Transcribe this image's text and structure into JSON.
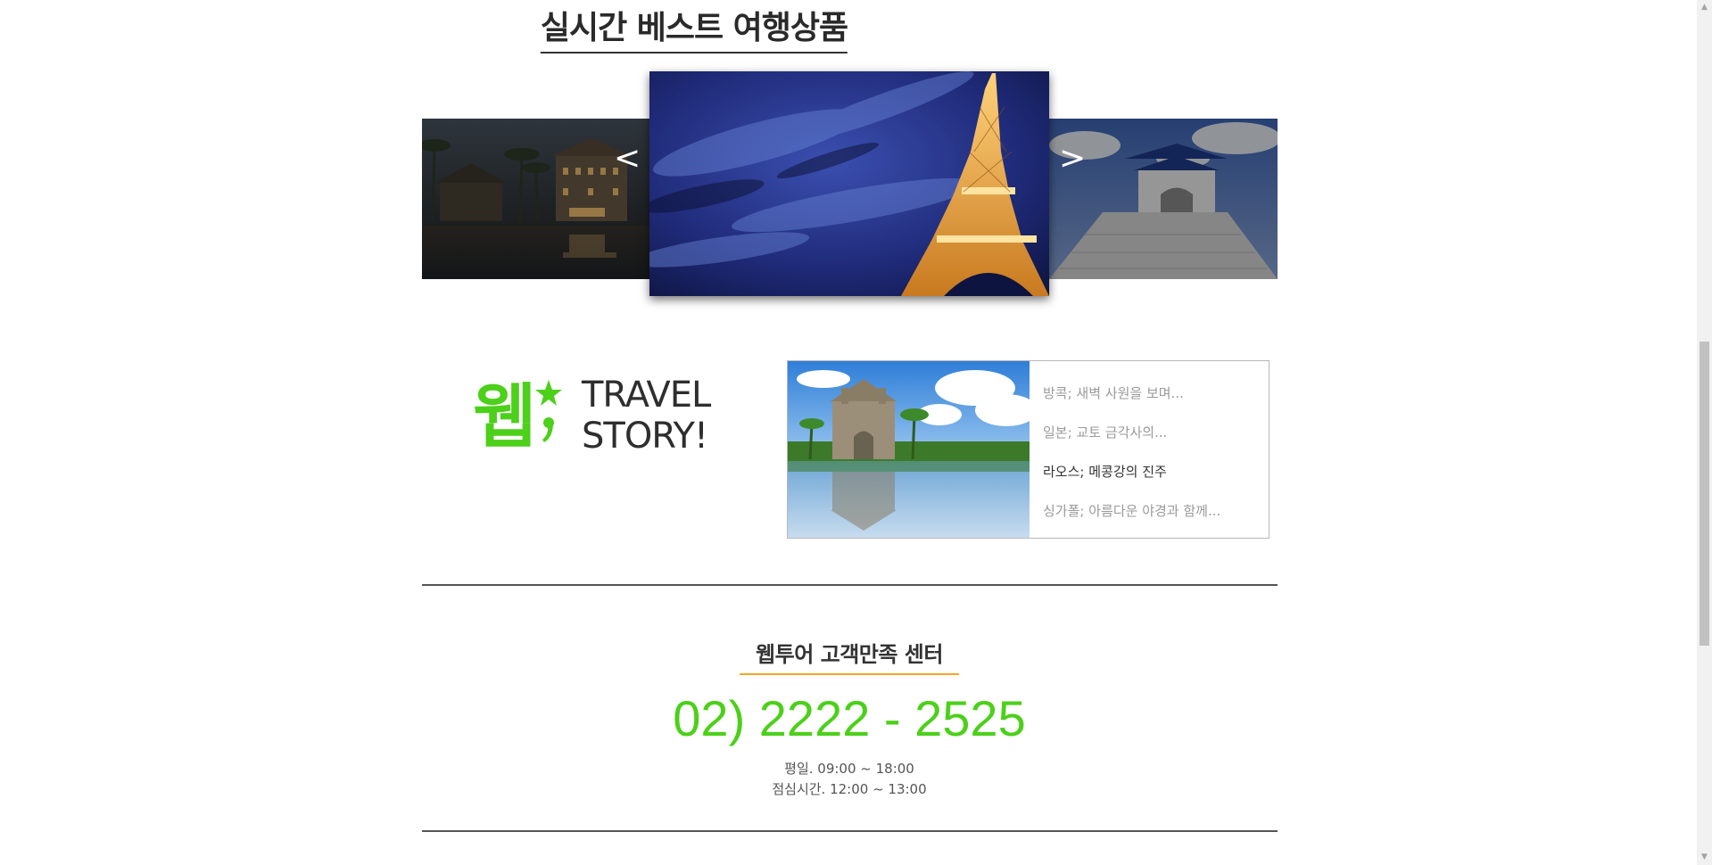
{
  "best": {
    "title": "실시간 베스트 여행상품",
    "prev_label": "<",
    "next_label": ">"
  },
  "story": {
    "logo_text": "웹",
    "title_line1": "TRAVEL",
    "title_line2": "STORY!",
    "items": [
      {
        "label": "방콕; 새벽 사원을 보며..."
      },
      {
        "label": "일본; 교토 금각사의..."
      },
      {
        "label": "라오스; 메콩강의 진주"
      },
      {
        "label": "싱가폴; 아름다운 야경과 함께..."
      }
    ],
    "active_index": 2
  },
  "customer_center": {
    "title": "웹투어 고객만족 센터",
    "phone": "02) 2222 - 2525",
    "hours_weekday": "평일. 09:00 ~ 18:00",
    "hours_lunch": "점심시간. 12:00 ~ 13:00"
  },
  "colors": {
    "accent_green": "#4cd01a",
    "accent_orange": "#f5a623"
  }
}
